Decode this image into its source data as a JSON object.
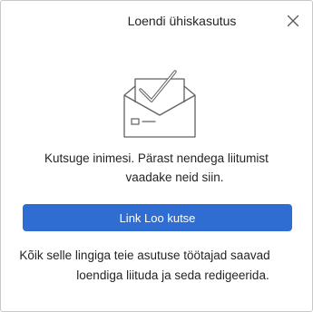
{
  "dialog": {
    "title": "Loendi ühiskasutus",
    "close_icon": "close-icon",
    "illustration_icon": "envelope-checkmark-icon",
    "message_line1": "Kutsuge inimesi. Pärast nendega liitumist",
    "message_line2": "vaadake neid siin.",
    "primary_button_label": "Link Loo kutse",
    "note_line1": "Kõik selle lingiga teie asutuse töötajad saavad",
    "note_line2": "loendiga liituda ja seda redigeerida.",
    "colors": {
      "accent": "#2f6dd2",
      "text": "#242424",
      "icon_stroke": "#616161"
    }
  }
}
